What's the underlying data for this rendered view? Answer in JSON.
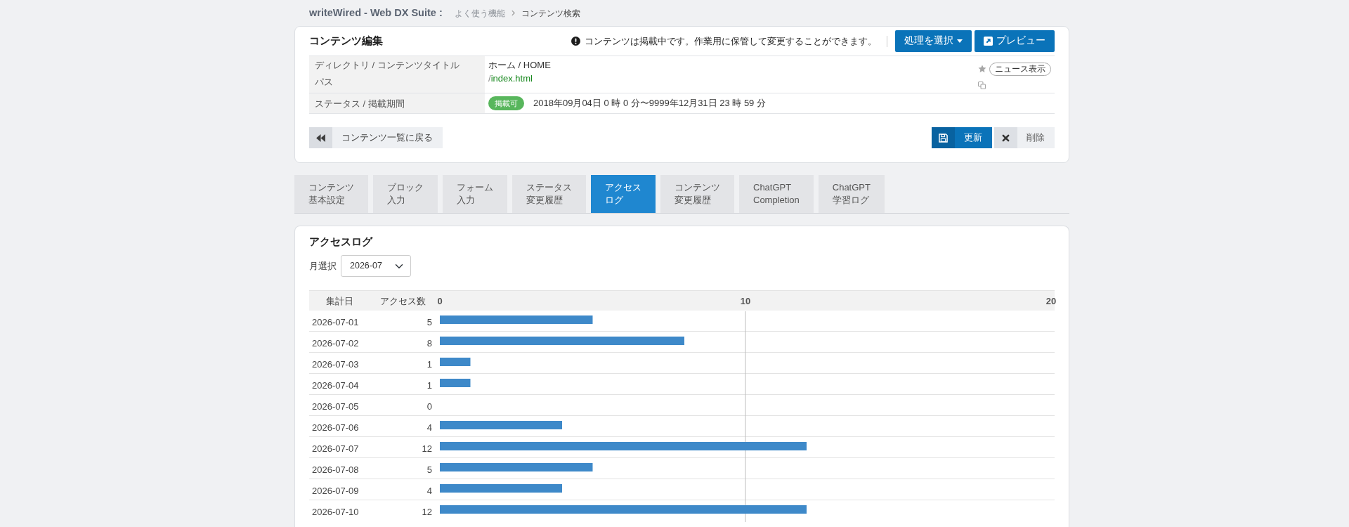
{
  "header": {
    "app_title": "writeWired - Web DX Suite :",
    "breadcrumb": [
      "よく使う機能",
      "コンテンツ検索"
    ]
  },
  "editor": {
    "title": "コンテンツ編集",
    "notice": "コンテンツは掲載中です。作業用に保管して変更することができます。",
    "actions": [
      {
        "kind": "dropdown",
        "label": "処理を選択"
      },
      {
        "kind": "preview",
        "label": "プレビュー"
      }
    ],
    "rows": [
      {
        "kind": "path",
        "labels": [
          "ディレクトリ / コンテンツタイトル",
          "パス"
        ],
        "title": "ホーム / HOME",
        "path_prefix": "/",
        "path": "index.html",
        "news_button": "ニュース表示"
      },
      {
        "kind": "status",
        "labels": [
          "ステータス / 掲載期間"
        ],
        "status": "掲載可",
        "period": "2018年09月04日 0 時 0 分〜9999年12月31日 23 時 59 分"
      }
    ],
    "back_button": "コンテンツ一覧に戻る",
    "update_button": "更新",
    "delete_button": "削除"
  },
  "tabs": [
    {
      "lines": [
        "コンテンツ",
        "基本設定"
      ],
      "selected": false
    },
    {
      "lines": [
        "ブロック",
        "入力"
      ],
      "selected": false
    },
    {
      "lines": [
        "フォーム",
        "入力"
      ],
      "selected": false
    },
    {
      "lines": [
        "ステータス",
        "変更履歴"
      ],
      "selected": false
    },
    {
      "lines": [
        "アクセス",
        "ログ"
      ],
      "selected": true
    },
    {
      "lines": [
        "コンテンツ",
        "変更履歴"
      ],
      "selected": false
    },
    {
      "lines": [
        "ChatGPT",
        "Completion"
      ],
      "selected": false
    },
    {
      "lines": [
        "ChatGPT",
        "学習ログ"
      ],
      "selected": false
    }
  ],
  "access_log": {
    "title": "アクセスログ",
    "month_label": "月選択",
    "month_value": "2026-07",
    "columns": [
      "集計日",
      "アクセス数"
    ],
    "chart_data": {
      "type": "bar",
      "orientation": "horizontal",
      "categories": [
        "2026-07-01",
        "2026-07-02",
        "2026-07-03",
        "2026-07-04",
        "2026-07-05",
        "2026-07-06",
        "2026-07-07",
        "2026-07-08",
        "2026-07-09",
        "2026-07-10"
      ],
      "values": [
        5,
        8,
        1,
        1,
        0,
        4,
        12,
        5,
        4,
        12
      ],
      "xlim": [
        0,
        20
      ],
      "xticks": [
        0,
        10,
        20
      ],
      "data_labels": true
    }
  }
}
